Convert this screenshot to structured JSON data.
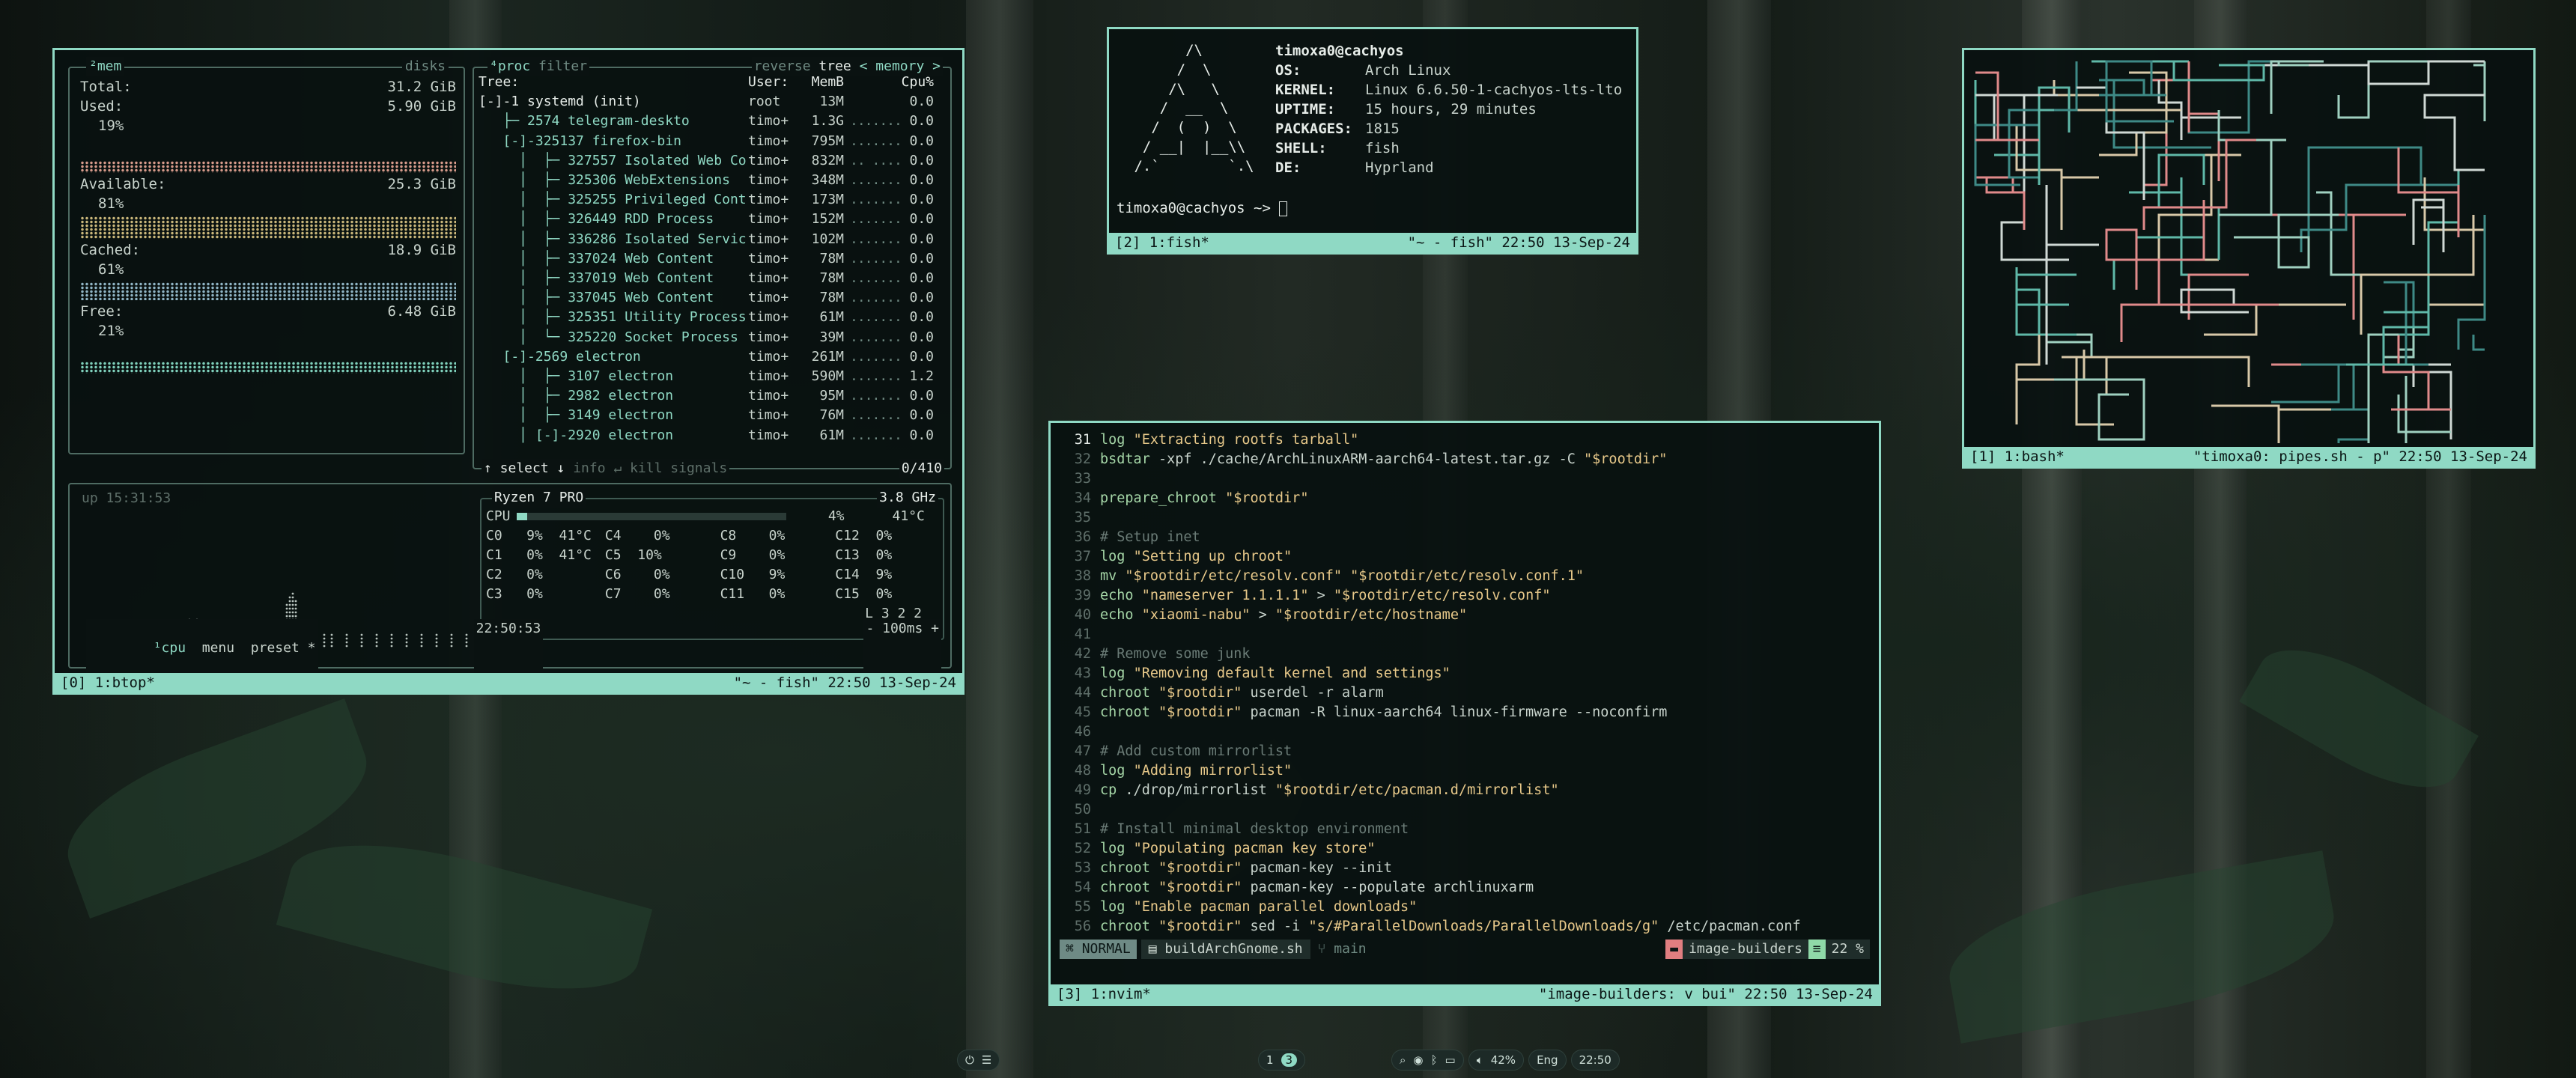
{
  "btop": {
    "status_left": "[0] 1:btop*",
    "status_right": "\"~ - fish\" 22:50 13-Sep-24",
    "mem": {
      "title": "²mem",
      "disks_title": "disks",
      "rows": [
        {
          "label": "Total:",
          "value": "31.2 GiB"
        },
        {
          "label": "Used:",
          "value": "5.90 GiB",
          "pct": "19%"
        },
        {
          "label": "Available:",
          "value": "25.3 GiB",
          "pct": "81%"
        },
        {
          "label": "Cached:",
          "value": "18.9 GiB",
          "pct": "61%"
        },
        {
          "label": "Free:",
          "value": "6.48 GiB",
          "pct": "21%"
        }
      ]
    },
    "proc": {
      "title": "⁴proc",
      "filter": "filter",
      "reverse": "reverse",
      "tree": "tree",
      "sort": "< memory >",
      "headers": {
        "tree": "Tree:",
        "user": "User:",
        "mem": "MemB",
        "cpu": "Cpu%"
      },
      "rows": [
        {
          "tree": "[-]-1 systemd (init)",
          "user": "root",
          "mem": "13M",
          "graph": "",
          "cpu": "0.0"
        },
        {
          "tree": "   ├─ 2574 telegram-deskto",
          "user": "timo+",
          "mem": "1.3G",
          "graph": ".......",
          "cpu": "0.0"
        },
        {
          "tree": "   [-]-325137 firefox-bin",
          "user": "timo+",
          "mem": "795M",
          "graph": ".......",
          "cpu": "0.0"
        },
        {
          "tree": "     │  ├─ 327557 Isolated Web Co",
          "user": "timo+",
          "mem": "832M",
          "graph": ".. ....",
          "cpu": "0.0"
        },
        {
          "tree": "     │  ├─ 325306 WebExtensions",
          "user": "timo+",
          "mem": "348M",
          "graph": ".......",
          "cpu": "0.0"
        },
        {
          "tree": "     │  ├─ 325255 Privileged Cont",
          "user": "timo+",
          "mem": "173M",
          "graph": ".......",
          "cpu": "0.0"
        },
        {
          "tree": "     │  ├─ 326449 RDD Process",
          "user": "timo+",
          "mem": "152M",
          "graph": ".......",
          "cpu": "0.0"
        },
        {
          "tree": "     │  ├─ 336286 Isolated Servic",
          "user": "timo+",
          "mem": "102M",
          "graph": ".......",
          "cpu": "0.0"
        },
        {
          "tree": "     │  ├─ 337024 Web Content",
          "user": "timo+",
          "mem": "78M",
          "graph": ".......",
          "cpu": "0.0"
        },
        {
          "tree": "     │  ├─ 337019 Web Content",
          "user": "timo+",
          "mem": "78M",
          "graph": ".......",
          "cpu": "0.0"
        },
        {
          "tree": "     │  ├─ 337045 Web Content",
          "user": "timo+",
          "mem": "78M",
          "graph": ".......",
          "cpu": "0.0"
        },
        {
          "tree": "     │  ├─ 325351 Utility Process",
          "user": "timo+",
          "mem": "61M",
          "graph": ".......",
          "cpu": "0.0"
        },
        {
          "tree": "     │  └─ 325220 Socket Process",
          "user": "timo+",
          "mem": "39M",
          "graph": ".......",
          "cpu": "0.0"
        },
        {
          "tree": "   [-]-2569 electron",
          "user": "timo+",
          "mem": "261M",
          "graph": ".......",
          "cpu": "0.0"
        },
        {
          "tree": "     │  ├─ 3107 electron",
          "user": "timo+",
          "mem": "590M",
          "graph": ".......",
          "cpu": "1.2"
        },
        {
          "tree": "     │  ├─ 2982 electron",
          "user": "timo+",
          "mem": "95M",
          "graph": ".......",
          "cpu": "0.0"
        },
        {
          "tree": "     │  ├─ 3149 electron",
          "user": "timo+",
          "mem": "76M",
          "graph": ".......",
          "cpu": "0.0"
        },
        {
          "tree": "     │ [-]-2920 electron",
          "user": "timo+",
          "mem": "61M",
          "graph": ".......",
          "cpu": "0.0"
        }
      ],
      "footer_select": "↑ select ↓",
      "footer_info": "info ↵",
      "footer_kill": "kill",
      "footer_signals": "signals",
      "footer_count": "0/410"
    },
    "cpu": {
      "uptime": "up 15:31:53",
      "model": "Ryzen 7 PRO",
      "freq": "3.8 GHz",
      "total_label": "CPU",
      "total_pct": "4%",
      "total_temp": "41°C",
      "total_fill": 0.04,
      "cores": [
        "C0   9%  41°C",
        "C4    0%",
        "C8    0%",
        "C12  0%",
        "C1   0%  41°C",
        "C5  10%",
        "C9    0%",
        "C13  0%",
        "C2   0%",
        "C6    0%",
        "C10   9%",
        "C14  9%",
        "C3   0%",
        "C7    0%",
        "C11   0%",
        "C15  0%"
      ],
      "load": "L 3 2 2",
      "tab_cpu": "¹cpu",
      "tab_menu": "menu",
      "tab_preset": "preset *",
      "clock": "22:50:53",
      "rate": "- 100ms +"
    }
  },
  "fetch": {
    "status_left": "[2] 1:fish*",
    "status_right": "\"~ - fish\" 22:50 13-Sep-24",
    "logo": [
      "       /\\",
      "      /  \\",
      "     /\\   \\",
      "    /  __  \\",
      "   /  (  )  \\",
      "  / __|  |__\\\\",
      " /.`        `.\\"
    ],
    "user_host": "timoxa0@cachyos",
    "info": [
      {
        "k": "OS:",
        "v": "Arch Linux"
      },
      {
        "k": "KERNEL:",
        "v": "Linux 6.6.50-1-cachyos-lts-lto"
      },
      {
        "k": "UPTIME:",
        "v": "15 hours, 29 minutes"
      },
      {
        "k": "PACKAGES:",
        "v": "1815"
      },
      {
        "k": "SHELL:",
        "v": "fish"
      },
      {
        "k": "DE:",
        "v": "Hyprland"
      }
    ],
    "prompt": "timoxa0@cachyos ~> "
  },
  "pipes": {
    "status_left": "[1] 1:bash*",
    "status_right": "\"timoxa0: pipes.sh - p\" 22:50 13-Sep-24"
  },
  "nvim": {
    "status_left": "[3] 1:nvim*",
    "status_right": "\"image-builders: v bui\" 22:50 13-Sep-24",
    "mode": "NORMAL",
    "file": "buildArchGnome.sh",
    "branch": "main",
    "project": "image-builders",
    "percent": "22 %",
    "lines": [
      {
        "n": "31",
        "t": "log \"Extracting rootfs tarball\""
      },
      {
        "n": "32",
        "t": "bsdtar -xpf ./cache/ArchLinuxARM-aarch64-latest.tar.gz -C \"$rootdir\""
      },
      {
        "n": "33",
        "t": ""
      },
      {
        "n": "34",
        "t": "prepare_chroot \"$rootdir\""
      },
      {
        "n": "35",
        "t": ""
      },
      {
        "n": "36",
        "t": "# Setup inet"
      },
      {
        "n": "37",
        "t": "log \"Setting up chroot\""
      },
      {
        "n": "38",
        "t": "mv \"$rootdir/etc/resolv.conf\" \"$rootdir/etc/resolv.conf.1\""
      },
      {
        "n": "39",
        "t": "echo \"nameserver 1.1.1.1\" > \"$rootdir/etc/resolv.conf\""
      },
      {
        "n": "40",
        "t": "echo \"xiaomi-nabu\" > \"$rootdir/etc/hostname\""
      },
      {
        "n": "41",
        "t": ""
      },
      {
        "n": "42",
        "t": "# Remove some junk"
      },
      {
        "n": "43",
        "t": "log \"Removing default kernel and settings\""
      },
      {
        "n": "44",
        "t": "chroot \"$rootdir\" userdel -r alarm"
      },
      {
        "n": "45",
        "t": "chroot \"$rootdir\" pacman -R linux-aarch64 linux-firmware --noconfirm"
      },
      {
        "n": "46",
        "t": ""
      },
      {
        "n": "47",
        "t": "# Add custom mirrorlist"
      },
      {
        "n": "48",
        "t": "log \"Adding mirrorlist\""
      },
      {
        "n": "49",
        "t": "cp ./drop/mirrorlist \"$rootdir/etc/pacman.d/mirrorlist\""
      },
      {
        "n": "50",
        "t": ""
      },
      {
        "n": "51",
        "t": "# Install minimal desktop environment"
      },
      {
        "n": "52",
        "t": "log \"Populating pacman key store\""
      },
      {
        "n": "53",
        "t": "chroot \"$rootdir\" pacman-key --init"
      },
      {
        "n": "54",
        "t": "chroot \"$rootdir\" pacman-key --populate archlinuxarm"
      },
      {
        "n": "55",
        "t": "log \"Enable pacman parallel downloads\""
      },
      {
        "n": "56",
        "t": "chroot \"$rootdir\" sed -i \"s/#ParallelDownloads/ParallelDownloads/g\" /etc/pacman.conf"
      }
    ]
  },
  "taskbar": {
    "ws1": "1",
    "ws3": "3",
    "volume": "42%",
    "lang": "Eng",
    "clock": "22:50"
  }
}
